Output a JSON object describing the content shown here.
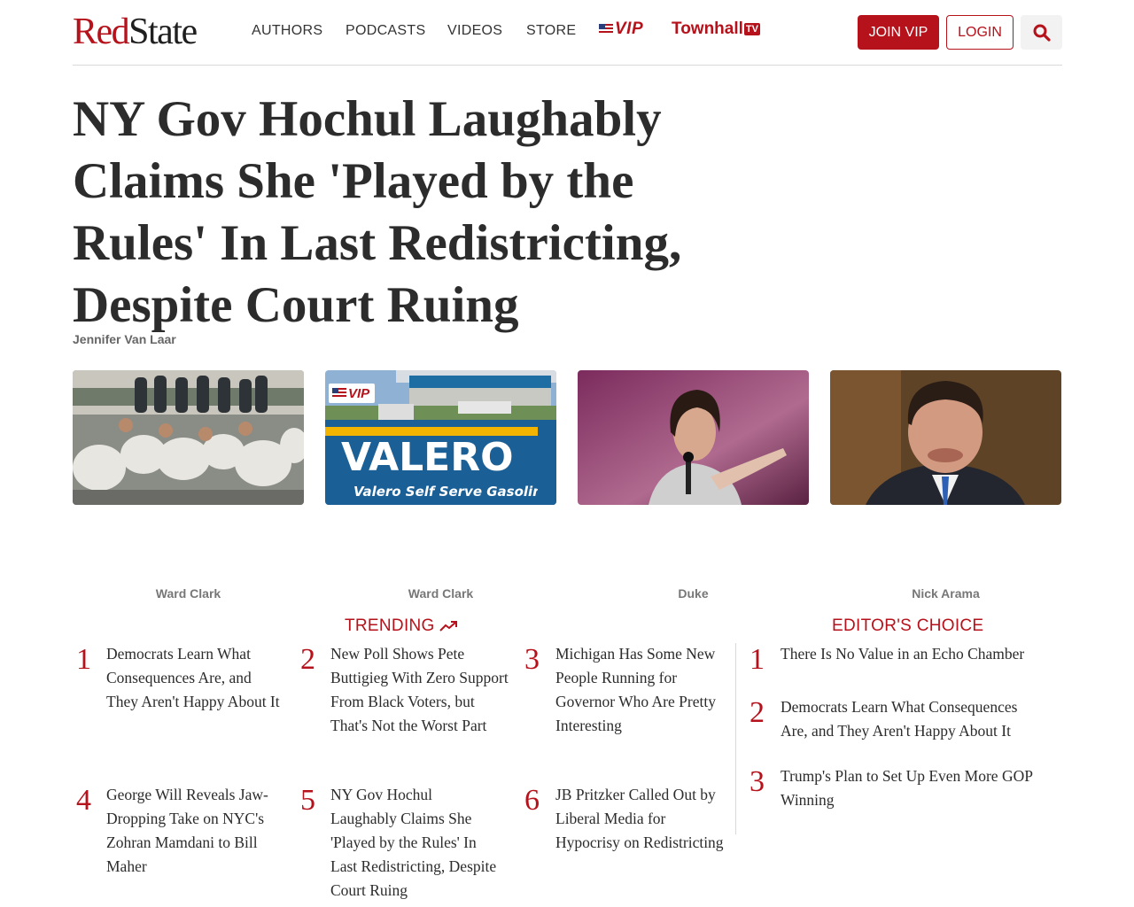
{
  "brand": {
    "name_part1": "Red",
    "name_part2": "State",
    "color": "#b5121b"
  },
  "nav": {
    "items": [
      "AUTHORS",
      "PODCASTS",
      "VIDEOS",
      "STORE"
    ],
    "vip_label": "VIP",
    "townhall_label": "Townhall",
    "townhall_tv": "TV"
  },
  "header_buttons": {
    "join": "JOIN VIP",
    "login": "LOGIN",
    "search_icon": "search-icon"
  },
  "article": {
    "title": "NY Gov Hochul Laughably Claims She 'Played by the Rules' In Last Redistricting, Despite Court Ruing",
    "author": "Jennifer Van Laar"
  },
  "cards": [
    {
      "author": "Ward Clark",
      "vip": false
    },
    {
      "author": "Ward Clark",
      "vip": true,
      "vip_label": "VIP",
      "sign_text": "VALERO",
      "sign_subtext": "Valero Self Serve Gasoline"
    },
    {
      "author": "Duke",
      "vip": false
    },
    {
      "author": "Nick Arama",
      "vip": false
    }
  ],
  "trending": {
    "title": "TRENDING",
    "items": [
      {
        "rank": "1",
        "text": "Democrats Learn What Consequences Are, and They Aren't Happy About It"
      },
      {
        "rank": "2",
        "text": "New Poll Shows Pete Buttigieg With Zero Support From Black Voters, but That's Not the Worst Part"
      },
      {
        "rank": "3",
        "text": "Michigan Has Some New People Running for Governor Who Are Pretty Interesting"
      },
      {
        "rank": "4",
        "text": "George Will Reveals Jaw-Dropping Take on NYC's Zohran Mamdani to Bill Maher"
      },
      {
        "rank": "5",
        "text": "NY Gov Hochul Laughably Claims She 'Played by the Rules' In Last Redistricting, Despite Court Ruing"
      },
      {
        "rank": "6",
        "text": "JB Pritzker Called Out by Liberal Media for Hypocrisy on Redistricting"
      }
    ]
  },
  "editors_choice": {
    "title": "EDITOR'S CHOICE",
    "items": [
      {
        "rank": "1",
        "text": "There Is No Value in an Echo Chamber"
      },
      {
        "rank": "2",
        "text": "Democrats Learn What Consequences Are, and They Aren't Happy About It"
      },
      {
        "rank": "3",
        "text": "Trump's Plan to Set Up Even More GOP Winning"
      }
    ]
  }
}
